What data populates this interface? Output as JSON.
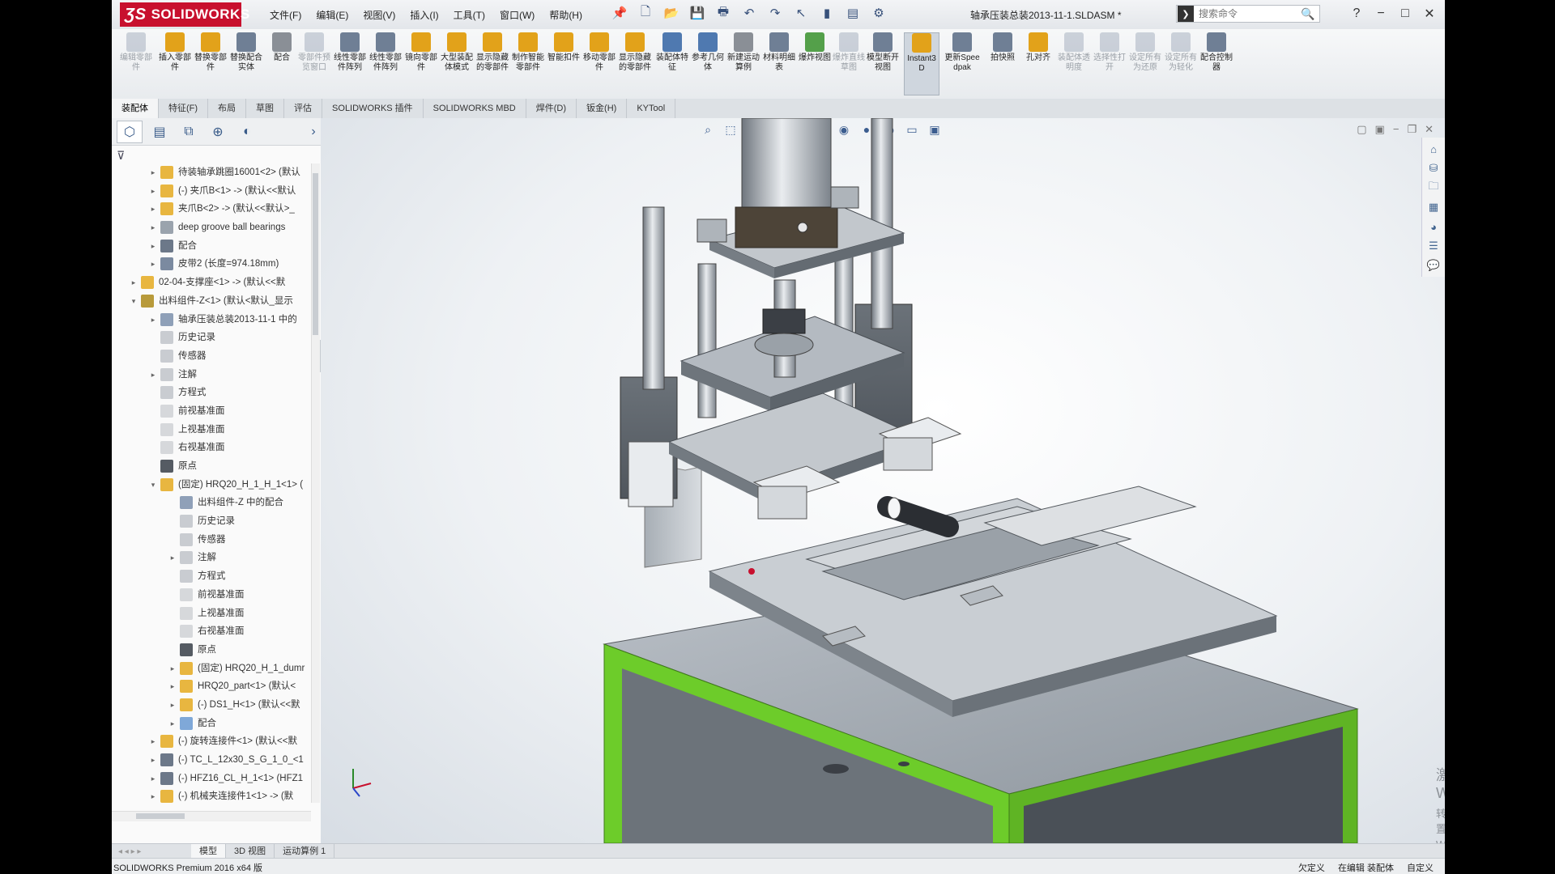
{
  "app": {
    "brand": "SOLIDWORKS",
    "document_title": "轴承压装总装2013-11-1.SLDASM *",
    "menu": [
      "文件(F)",
      "编辑(E)",
      "视图(V)",
      "插入(I)",
      "工具(T)",
      "窗口(W)",
      "帮助(H)"
    ],
    "search_placeholder": "搜索命令"
  },
  "ribbon": {
    "buttons": [
      {
        "label": "编辑零部件",
        "dim": true,
        "color": "#7a8aa0"
      },
      {
        "label": "插入零部件",
        "dim": false,
        "color": "#e2a21a"
      },
      {
        "label": "替换零部件",
        "dim": false,
        "color": "#e2a21a"
      },
      {
        "label": "替换配合实体",
        "dim": false,
        "color": "#6f7f95"
      },
      {
        "label": "配合",
        "dim": false,
        "color": "#8a8f96"
      },
      {
        "label": "零部件预览窗口",
        "dim": true,
        "color": "#7a8aa0"
      },
      {
        "label": "线性零部件阵列",
        "dim": false,
        "color": "#6f7f95"
      },
      {
        "label": "线性零部件阵列",
        "dim": false,
        "color": "#6f7f95"
      },
      {
        "label": "镜向零部件",
        "dim": false,
        "color": "#e2a21a"
      },
      {
        "label": "大型装配体模式",
        "dim": false,
        "color": "#e2a21a"
      },
      {
        "label": "显示隐藏的零部件",
        "dim": false,
        "color": "#e2a21a"
      },
      {
        "label": "制作智能零部件",
        "dim": false,
        "color": "#e2a21a"
      },
      {
        "label": "智能扣件",
        "dim": false,
        "color": "#e2a21a"
      },
      {
        "label": "移动零部件",
        "dim": false,
        "color": "#e2a21a"
      },
      {
        "label": "显示隐藏的零部件",
        "dim": false,
        "color": "#e2a21a"
      },
      {
        "label": "装配体特征",
        "dim": false,
        "color": "#4f79b0"
      },
      {
        "label": "参考几何体",
        "dim": false,
        "color": "#4f79b0"
      },
      {
        "label": "新建运动算例",
        "dim": false,
        "color": "#8a8f96"
      },
      {
        "label": "材料明细表",
        "dim": false,
        "color": "#6f7f95"
      },
      {
        "label": "爆炸视图",
        "dim": false,
        "color": "#54a04a"
      },
      {
        "label": "爆炸直线草图",
        "dim": true,
        "color": "#7a8aa0"
      },
      {
        "label": "模型断开视图",
        "dim": false,
        "color": "#6f7f95"
      },
      {
        "label": "Instant3D",
        "dim": false,
        "active": true,
        "color": "#e2a21a"
      },
      {
        "label": "更新Speedpak",
        "dim": false,
        "color": "#6f7f95"
      },
      {
        "label": "拍快照",
        "dim": false,
        "color": "#6f7f95"
      },
      {
        "label": "孔对齐",
        "dim": false,
        "color": "#e2a21a"
      },
      {
        "label": "装配体透明度",
        "dim": true,
        "color": "#7a8aa0"
      },
      {
        "label": "选择性打开",
        "dim": true,
        "color": "#7a8aa0"
      },
      {
        "label": "设定所有为还原",
        "dim": true,
        "color": "#7a8aa0"
      },
      {
        "label": "设定所有为轻化",
        "dim": true,
        "color": "#7a8aa0"
      },
      {
        "label": "配合控制器",
        "dim": false,
        "color": "#6f7f95"
      }
    ]
  },
  "command_tabs": [
    "装配体",
    "特征(F)",
    "布局",
    "草图",
    "评估",
    "SOLIDWORKS 插件",
    "SOLIDWORKS MBD",
    "焊件(D)",
    "钣金(H)",
    "KYTool"
  ],
  "tree": {
    "nodes": [
      {
        "indent": 1,
        "arrow": "▸",
        "icon": "#e8b640",
        "text": "待装轴承跳圈16001<2> (默认"
      },
      {
        "indent": 1,
        "arrow": "▸",
        "icon": "#e8b640",
        "text": "(-) 夹爪B<1> -> (默认<<默认"
      },
      {
        "indent": 1,
        "arrow": "▸",
        "icon": "#e8b640",
        "text": "夹爪B<2> -> (默认<<默认>_"
      },
      {
        "indent": 1,
        "arrow": "▸",
        "icon": "#9aa3ad",
        "text": "deep groove ball bearings"
      },
      {
        "indent": 1,
        "arrow": "▸",
        "icon": "#6c7889",
        "text": "配合"
      },
      {
        "indent": 1,
        "arrow": "▸",
        "icon": "#7b8aa0",
        "text": "皮带2 (长度=974.18mm)"
      },
      {
        "indent": 0,
        "arrow": "▸",
        "icon": "#e8b640",
        "text": "02-04-支撑座<1> -> (默认<<默"
      },
      {
        "indent": 0,
        "arrow": "▾",
        "icon": "#b89a3a",
        "text": "出料组件-Z<1> (默认<默认_显示"
      },
      {
        "indent": 1,
        "arrow": "▸",
        "icon": "#8fa0b8",
        "text": "轴承压装总装2013-11-1 中的"
      },
      {
        "indent": 1,
        "arrow": "",
        "icon": "#c9ccd1",
        "text": "历史记录"
      },
      {
        "indent": 1,
        "arrow": "",
        "icon": "#c9ccd1",
        "text": "传感器"
      },
      {
        "indent": 1,
        "arrow": "▸",
        "icon": "#c9ccd1",
        "text": "注解"
      },
      {
        "indent": 1,
        "arrow": "",
        "icon": "#c9ccd1",
        "text": "方程式"
      },
      {
        "indent": 1,
        "arrow": "",
        "icon": "#d6d8db",
        "text": "前视基准面"
      },
      {
        "indent": 1,
        "arrow": "",
        "icon": "#d6d8db",
        "text": "上视基准面"
      },
      {
        "indent": 1,
        "arrow": "",
        "icon": "#d6d8db",
        "text": "右视基准面"
      },
      {
        "indent": 1,
        "arrow": "",
        "icon": "#555b63",
        "text": "原点"
      },
      {
        "indent": 1,
        "arrow": "▾",
        "icon": "#e8b640",
        "text": "(固定) HRQ20_H_1_H_1<1> ("
      },
      {
        "indent": 2,
        "arrow": "",
        "icon": "#8fa0b8",
        "text": "出料组件-Z 中的配合"
      },
      {
        "indent": 2,
        "arrow": "",
        "icon": "#c9ccd1",
        "text": "历史记录"
      },
      {
        "indent": 2,
        "arrow": "",
        "icon": "#c9ccd1",
        "text": "传感器"
      },
      {
        "indent": 2,
        "arrow": "▸",
        "icon": "#c9ccd1",
        "text": "注解"
      },
      {
        "indent": 2,
        "arrow": "",
        "icon": "#c9ccd1",
        "text": "方程式"
      },
      {
        "indent": 2,
        "arrow": "",
        "icon": "#d6d8db",
        "text": "前视基准面"
      },
      {
        "indent": 2,
        "arrow": "",
        "icon": "#d6d8db",
        "text": "上视基准面"
      },
      {
        "indent": 2,
        "arrow": "",
        "icon": "#d6d8db",
        "text": "右视基准面"
      },
      {
        "indent": 2,
        "arrow": "",
        "icon": "#555b63",
        "text": "原点"
      },
      {
        "indent": 2,
        "arrow": "▸",
        "icon": "#e8b640",
        "text": "(固定) HRQ20_H_1_dumr"
      },
      {
        "indent": 2,
        "arrow": "▸",
        "icon": "#e8b640",
        "text": "HRQ20_part<1> (默认<"
      },
      {
        "indent": 2,
        "arrow": "▸",
        "icon": "#e8b640",
        "text": "(-) DS1_H<1> (默认<<默"
      },
      {
        "indent": 2,
        "arrow": "▸",
        "icon": "#7fa8d8",
        "text": "配合"
      },
      {
        "indent": 1,
        "arrow": "▸",
        "icon": "#e8b640",
        "text": "(-) 旋转连接件<1> (默认<<默"
      },
      {
        "indent": 1,
        "arrow": "▸",
        "icon": "#6c7889",
        "text": "(-) TC_L_12x30_S_G_1_0_<1"
      },
      {
        "indent": 1,
        "arrow": "▸",
        "icon": "#6c7889",
        "text": "(-) HFZ16_CL_H_1<1> (HFZ1"
      },
      {
        "indent": 1,
        "arrow": "▸",
        "icon": "#e8b640",
        "text": "(-) 机械夹连接件1<1> -> (默"
      }
    ]
  },
  "bottom_tabs": [
    "模型",
    "3D 视图",
    "运动算例 1"
  ],
  "status": {
    "left": "SOLIDWORKS Premium 2016 x64 版",
    "right": [
      "欠定义",
      "在编辑 装配体",
      "自定义"
    ]
  },
  "watermark": {
    "line1": "激活 Windows",
    "line2": "转到\"设置\"以激活 Windows。"
  },
  "colors": {
    "machine_base_green": "#6dcc2a",
    "machine_grey": "#8f979f",
    "cylinder_dark": "#3b3f45"
  }
}
